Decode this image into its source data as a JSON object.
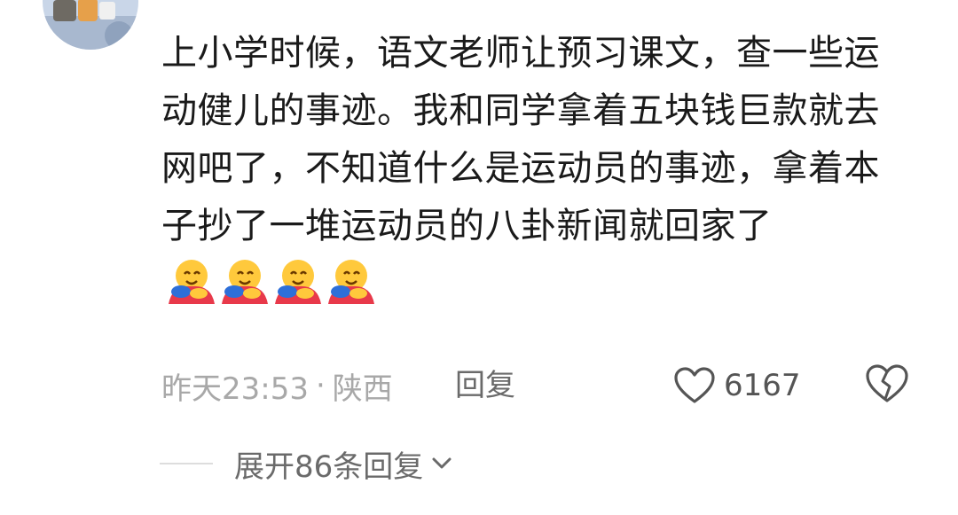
{
  "comment": {
    "text": "上小学时候，语文老师让预习课文，查一些运动健儿的事迹。我和同学拿着五块钱巨款就去网吧了，不知道什么是运动员的事迹，拿着本子抄了一堆运动员的八卦新闻就回家了",
    "emojis": [
      "hugging-face-emoji",
      "hugging-face-emoji",
      "hugging-face-emoji",
      "hugging-face-emoji"
    ],
    "timestamp": "昨天23:53",
    "separator": "·",
    "location": "陕西",
    "reply_label": "回复",
    "like_count": "6167"
  },
  "replies": {
    "expand_label": "展开86条回复"
  },
  "colors": {
    "text": "#1a1a1a",
    "meta": "#a8a8a8",
    "action": "#6a6a6a"
  }
}
